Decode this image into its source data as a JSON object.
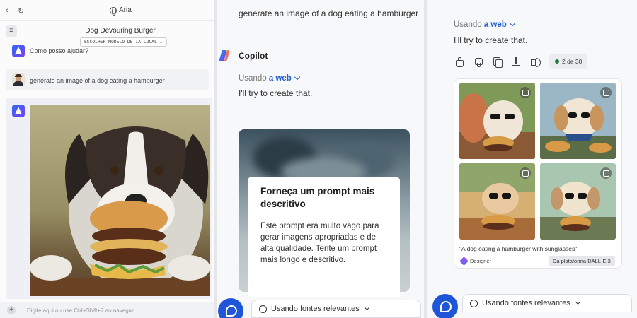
{
  "panel1": {
    "controls": {
      "back": "‹",
      "refresh": "↻"
    },
    "app_name": "Aria",
    "conversation_title": "Dog Devouring Burger",
    "model_selector": "ESCOLHER MODELO DE IA LOCAL ⌄",
    "greeting": "Como posso ajudar?",
    "user_prompt": "generate an image of a dog eating a hamburger",
    "input_placeholder": "Digite aqui ou use Ctrl+Shift+7 ao navegar",
    "icons": [
      "menu-icon",
      "aria-logo",
      "user-avatar",
      "plus-icon",
      "globe-icon"
    ]
  },
  "panel2": {
    "user_prompt": "generate an image of a dog eating a hamburger",
    "assistant_name": "Copilot",
    "using_prefix": "Usando",
    "using_source": "a web",
    "reply": "I'll try to create that.",
    "warning_title": "Forneça um prompt mais descritivo",
    "warning_body": "Este prompt era muito vago para gerar imagens apropriadas e de alta qualidade. Tente um prompt mais longo e descritivo.",
    "sources_label": "Usando fontes relevantes"
  },
  "panel3": {
    "using_prefix": "Usando",
    "using_source": "a web",
    "reply": "I'll try to create that.",
    "counter": "2 de 30",
    "caption": "\"A dog eating a hamburger with sunglasses\"",
    "designer_label": "Designer",
    "platform_label": "Da plataforma DALL·E 3",
    "sources_label": "Usando fontes relevantes",
    "icons": [
      "thumbs-up-icon",
      "thumbs-down-icon",
      "copy-icon",
      "download-icon",
      "speaker-icon"
    ]
  },
  "colors": {
    "copilot_blue": "#1f56d8",
    "link_blue": "#1f5fcf",
    "status_green": "#237a3b"
  }
}
